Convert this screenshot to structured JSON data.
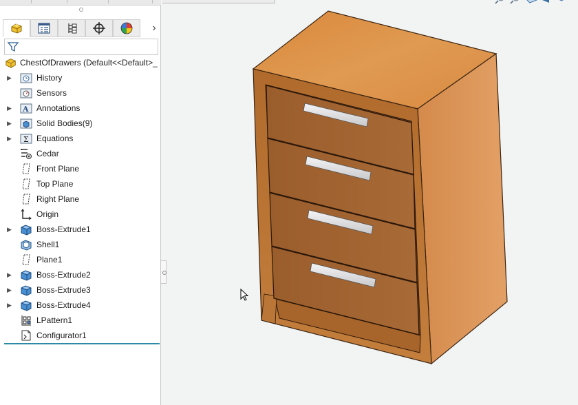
{
  "window": {
    "title": ""
  },
  "panel": {
    "tabs": [
      {
        "name": "feature-manager",
        "icon": "part-icon",
        "active": true
      },
      {
        "name": "property-manager",
        "icon": "property-icon",
        "active": false
      },
      {
        "name": "configuration-manager",
        "icon": "configuration-icon",
        "active": false
      },
      {
        "name": "dimxpert-manager",
        "icon": "crosshair-icon",
        "active": false
      },
      {
        "name": "display-manager",
        "icon": "appearance-pie-icon",
        "active": false
      }
    ],
    "tab_next_glyph": "›",
    "filter": {
      "icon": "filter-icon",
      "value": ""
    }
  },
  "tree": {
    "root": {
      "label": "ChestOfDrawers  (Default<<Default>_",
      "icon": "part-icon"
    },
    "items": [
      {
        "label": "History",
        "icon": "history-folder-icon",
        "expandable": true
      },
      {
        "label": "Sensors",
        "icon": "sensor-folder-icon",
        "expandable": false
      },
      {
        "label": "Annotations",
        "icon": "annotations-folder-icon",
        "expandable": true
      },
      {
        "label": "Solid Bodies(9)",
        "icon": "solid-bodies-folder-icon",
        "expandable": true
      },
      {
        "label": "Equations",
        "icon": "equations-folder-icon",
        "expandable": true
      },
      {
        "label": "Cedar",
        "icon": "material-icon",
        "expandable": false
      },
      {
        "label": "Front Plane",
        "icon": "plane-icon",
        "expandable": false
      },
      {
        "label": "Top Plane",
        "icon": "plane-icon",
        "expandable": false
      },
      {
        "label": "Right Plane",
        "icon": "plane-icon",
        "expandable": false
      },
      {
        "label": "Origin",
        "icon": "origin-icon",
        "expandable": false
      },
      {
        "label": "Boss-Extrude1",
        "icon": "extrude-icon",
        "expandable": true
      },
      {
        "label": "Shell1",
        "icon": "shell-icon",
        "expandable": false
      },
      {
        "label": "Plane1",
        "icon": "plane-icon",
        "expandable": false
      },
      {
        "label": "Boss-Extrude2",
        "icon": "extrude-icon",
        "expandable": true
      },
      {
        "label": "Boss-Extrude3",
        "icon": "extrude-icon",
        "expandable": true
      },
      {
        "label": "Boss-Extrude4",
        "icon": "extrude-icon",
        "expandable": true
      },
      {
        "label": "LPattern1",
        "icon": "linear-pattern-icon",
        "expandable": false
      },
      {
        "label": "Configurator1",
        "icon": "configurator-icon",
        "expandable": false
      }
    ],
    "expand_glyph": "▶"
  },
  "viewport": {
    "model": "chest-of-drawers",
    "drawer_count": 4,
    "colors": {
      "wood_top": "#d8893f",
      "wood_side": "#d28a4a",
      "wood_front": "#b8722f",
      "drawer": "#9a5e2b",
      "handle": "#e8e8ea",
      "background": "#f2f3f3"
    }
  }
}
